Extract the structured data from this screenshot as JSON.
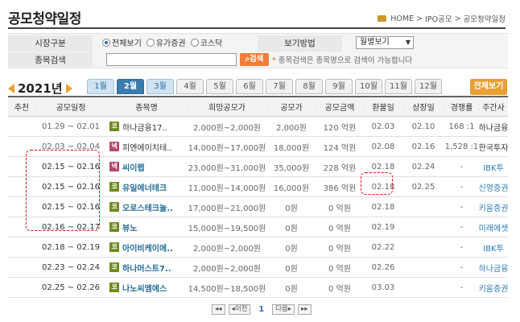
{
  "page": {
    "title": "공모청약일정",
    "breadcrumb": [
      "HOME",
      ">",
      "IPO공모",
      ">",
      "공모청약일정"
    ]
  },
  "search": {
    "market_label": "시장구분",
    "market_options": [
      {
        "label": "전체보기",
        "checked": true
      },
      {
        "label": "유가증권",
        "checked": false
      },
      {
        "label": "코스닥",
        "checked": false
      }
    ],
    "view_label": "보기방법",
    "view_value": "월별보기",
    "name_label": "종목검색",
    "name_value": "",
    "button_label": "검색",
    "hint": "종목검색은 종목명으로 검색이 가능합니다",
    "hint_star": "*"
  },
  "calendar": {
    "year": "2021년",
    "months": [
      "1월",
      "2월",
      "3월",
      "4월",
      "5월",
      "6월",
      "7월",
      "8월",
      "9월",
      "10월",
      "11월",
      "12월"
    ],
    "active_month": "2월",
    "all_label": "전체보기"
  },
  "table": {
    "headers": [
      "추천",
      "공모일정",
      "종목명",
      "희망공모가",
      "공모가",
      "공모금액",
      "환불일",
      "상장일",
      "경쟁률",
      "주간사"
    ],
    "rows": [
      {
        "rec": "",
        "schedule": "01.29 ~ 02.01",
        "market": "코",
        "name": "하나금융17..",
        "hope": "2,000원~2,000원",
        "price": "2,000원",
        "amount": "120 억원",
        "refund": "02.03",
        "listing": "02.10",
        "ratio": "168 :1",
        "underwriter": "하나금융"
      },
      {
        "rec": "",
        "schedule": "02.03 ~ 02.04",
        "market": "넥",
        "name": "피엔에이치테..",
        "hope": "14,000원~17,000원",
        "price": "18,000원",
        "amount": "124 억원",
        "refund": "02.08",
        "listing": "02.16",
        "ratio": "1,528 :1",
        "underwriter": "한국투자"
      },
      {
        "rec": "",
        "schedule": "02.15 ~ 02.16",
        "market": "넥",
        "name": "씨이랩",
        "hope": "23,000원~31,000원",
        "price": "35,000원",
        "amount": "228 억원",
        "refund": "02.18",
        "listing": "02.24",
        "ratio": "-",
        "underwriter": "IBK투"
      },
      {
        "rec": "",
        "schedule": "02.15 ~ 02.16",
        "market": "코",
        "name": "유일에너테크",
        "hope": "11,000원~14,000원",
        "price": "16,000원",
        "amount": "386 억원",
        "refund": "02.18",
        "listing": "02.25",
        "ratio": "-",
        "underwriter": "신영증권"
      },
      {
        "rec": "",
        "schedule": "02.15 ~ 02.16",
        "market": "코",
        "name": "오로스테크놀..",
        "hope": "17,000원~21,000원",
        "price": "0원",
        "amount": "0 억원",
        "refund": "02.18",
        "listing": "",
        "ratio": "-",
        "underwriter": "키움증권"
      },
      {
        "rec": "",
        "schedule": "02.16 ~ 02.17",
        "market": "코",
        "name": "뷰노",
        "hope": "15,000원~19,500원",
        "price": "0원",
        "amount": "0 억원",
        "refund": "02.19",
        "listing": "",
        "ratio": "-",
        "underwriter": "미래에셋"
      },
      {
        "rec": "",
        "schedule": "02.18 ~ 02.19",
        "market": "코",
        "name": "아이비케이에..",
        "hope": "2,000원~2,000원",
        "price": "0원",
        "amount": "0 억원",
        "refund": "02.22",
        "listing": "",
        "ratio": "-",
        "underwriter": "IBK투"
      },
      {
        "rec": "",
        "schedule": "02.23 ~ 02.24",
        "market": "코",
        "name": "하나머스트7..",
        "hope": "2,000원~2,000원",
        "price": "0원",
        "amount": "0 억원",
        "refund": "02.26",
        "listing": "",
        "ratio": "-",
        "underwriter": "하나금융"
      },
      {
        "rec": "",
        "schedule": "02.25 ~ 02.26",
        "market": "코",
        "name": "나노씨엠에스",
        "hope": "14,500원~18,500원",
        "price": "0원",
        "amount": "0 억원",
        "refund": "03.03",
        "listing": "",
        "ratio": "-",
        "underwriter": "키움증권"
      }
    ]
  },
  "pager": {
    "first": "◂◂",
    "prev": "◂이전",
    "current": "1",
    "next": "다음▸",
    "last": "▸▸"
  },
  "colors": {
    "accent": "#e8a032",
    "tab_active": "#3a7cae",
    "annotation": "#ee1111"
  }
}
